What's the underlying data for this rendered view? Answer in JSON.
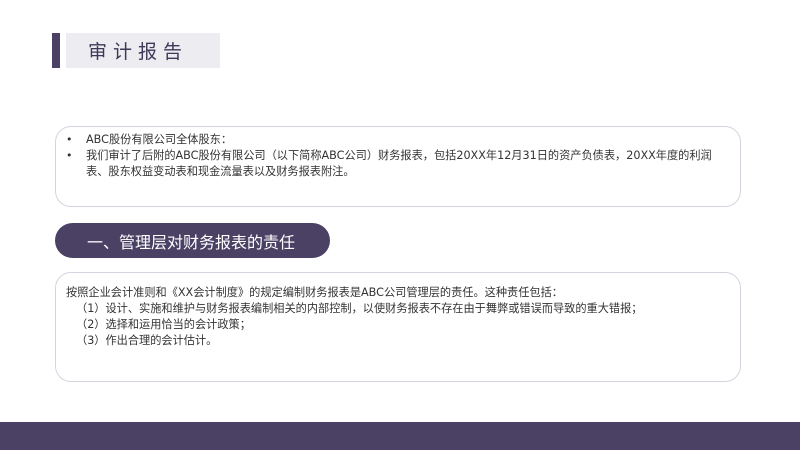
{
  "title": "审计报告",
  "intro": {
    "bullets": [
      "ABC股份有限公司全体股东：",
      "我们审计了后附的ABC股份有限公司（以下简称ABC公司）财务报表，包括20XX年12月31日的资产负债表，20XX年度的利润表、股东权益变动表和现金流量表以及财务报表附注。"
    ]
  },
  "section1": {
    "heading": "一、管理层对财务报表的责任",
    "lead": "按照企业会计准则和《XX会计制度》的规定编制财务报表是ABC公司管理层的责任。这种责任包括：",
    "items": [
      "（1）设计、实施和维护与财务报表编制相关的内部控制，以使财务报表不存在由于舞弊或错误而导致的重大错报；",
      "（2）选择和运用恰当的会计政策；",
      "（3）作出合理的会计估计。"
    ]
  },
  "colors": {
    "accent": "#4a4164",
    "title_bg": "#ececf1",
    "card_border": "#d6d3e0"
  }
}
